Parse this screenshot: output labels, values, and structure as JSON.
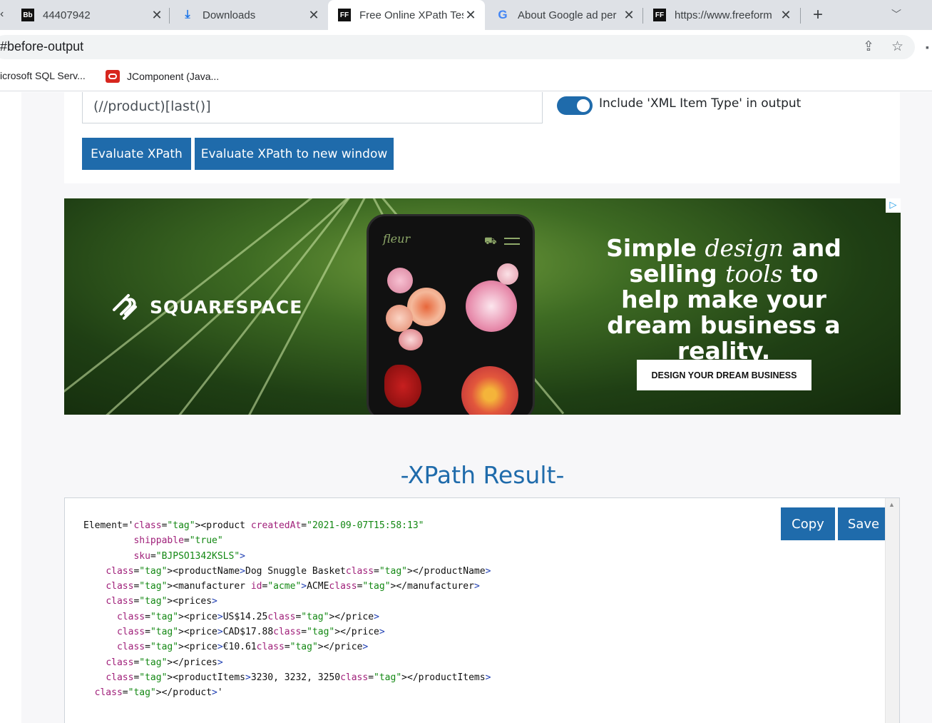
{
  "browser": {
    "tabs": [
      {
        "title": "44407942",
        "favicon": "Bb"
      },
      {
        "title": "Downloads",
        "favicon": "download-icon"
      },
      {
        "title": "Free Online XPath Tes",
        "favicon": "FF"
      },
      {
        "title": "About Google ad per",
        "favicon": "G"
      },
      {
        "title": "https://www.freeform",
        "favicon": "FF"
      }
    ],
    "address": "#before-output",
    "bookmarks": [
      {
        "label": "icrosoft SQL Serv..."
      },
      {
        "label": "JComponent (Java..."
      }
    ]
  },
  "form": {
    "xpath_value": "(//product)[last()]",
    "toggle_label": "Include 'XML Item Type' in output",
    "toggle_on": true,
    "evaluate_label": "Evaluate XPath",
    "evaluate_new_label": "Evaluate XPath to new window"
  },
  "ad": {
    "logo": "SQUARESPACE",
    "phone_brand": "fleur",
    "copy_parts": [
      "Simple ",
      "design",
      " and selling ",
      "tools",
      " to help make your dream business a reality."
    ],
    "cta": "DESIGN YOUR DREAM BUSINESS"
  },
  "result": {
    "heading": "-XPath Result-",
    "copy_label": "Copy",
    "save_label": "Save",
    "lines": [
      "Element='<product createdAt=\"2021-09-07T15:58:13\"",
      "         shippable=\"true\"",
      "         sku=\"BJPSO1342KSLS\">",
      "    <productName>Dog Snuggle Basket</productName>",
      "    <manufacturer id=\"acme\">ACME</manufacturer>",
      "    <prices>",
      "      <price>US$14.25</price>",
      "      <price>CAD$17.88</price>",
      "      <price>€10.61</price>",
      "    </prices>",
      "    <productItems>3230, 3232, 3250</productItems>",
      "  </product>'"
    ]
  },
  "colors": {
    "accent": "#1f6bab",
    "tag": "#1f3fb3",
    "attr": "#a0207a",
    "string": "#138813"
  }
}
